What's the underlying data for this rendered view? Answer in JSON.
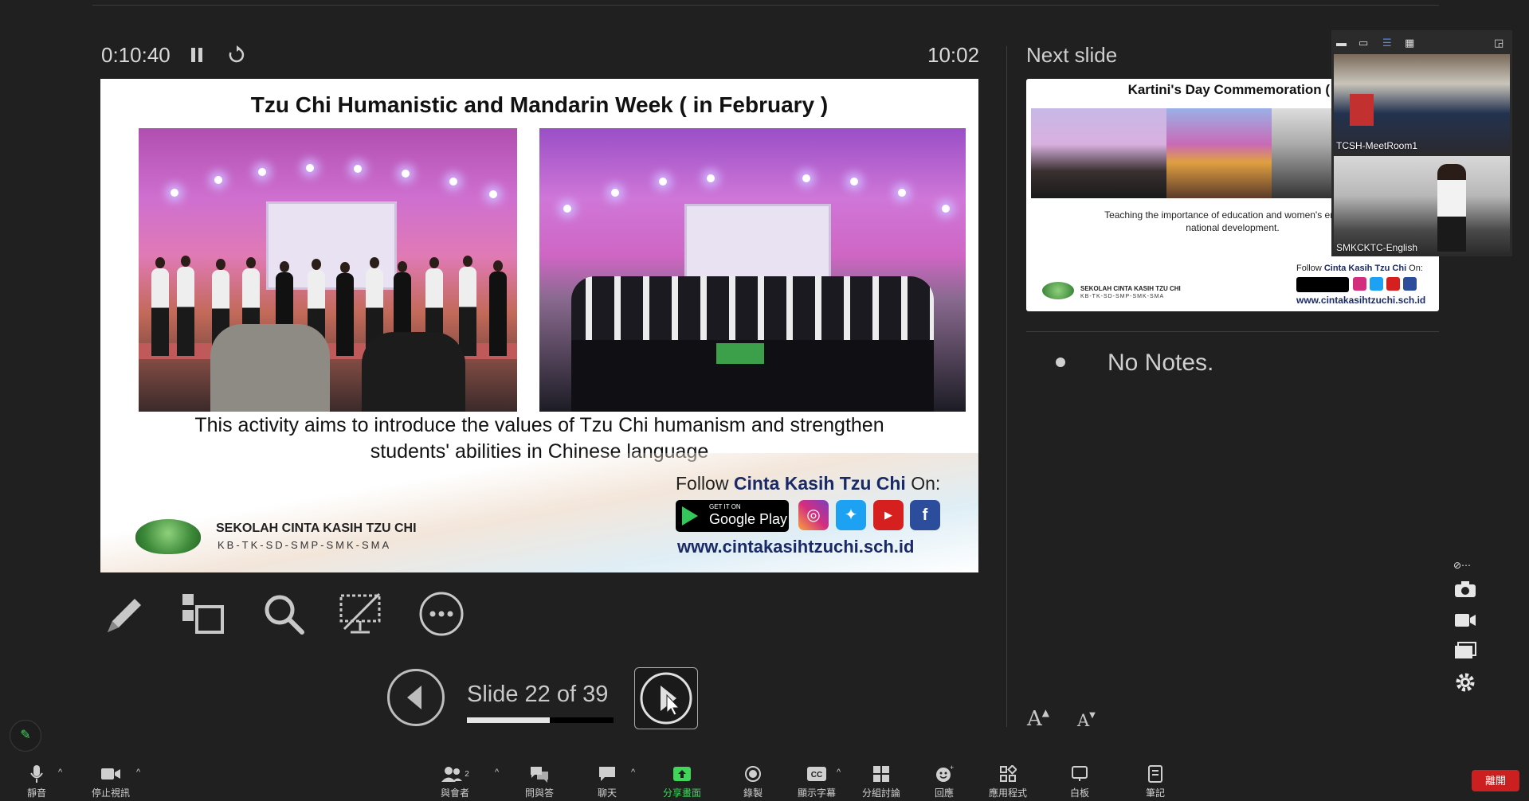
{
  "presenter": {
    "elapsed": "0:10:40",
    "clock": "10:02",
    "next_slide_label": "Next slide"
  },
  "slide": {
    "title": "Tzu Chi Humanistic and Mandarin Week ( in February )",
    "caption_line1": "This activity aims to introduce the values of Tzu Chi humanism and strengthen",
    "caption_line2": "students' abilities in Chinese language",
    "school_name": "SEKOLAH CINTA KASIH TZU CHI",
    "school_levels": "KB-TK-SD-SMP-SMK-SMA",
    "follow_prefix": "Follow ",
    "follow_brand": "Cinta Kasih Tzu Chi",
    "follow_suffix": " On:",
    "gplay_small": "GET IT ON",
    "gplay_big": "Google Play",
    "website": "www.cintakasihtzuchi.sch.id"
  },
  "navigation": {
    "slide_count": "Slide 22 of 39",
    "progress": 0.564
  },
  "next_slide": {
    "title": "Kartini's Day Commemoration ( i",
    "caption_line1": "Teaching the importance of education and women's empowe",
    "caption_line2": "national development.",
    "school_name": "SEKOLAH CINTA KASIH TZU CHI",
    "school_levels": "KB-TK-SD-SMP-SMK-SMA",
    "follow_prefix": "Follow ",
    "follow_brand": "Cinta Kasih Tzu Chi",
    "follow_suffix": " On:",
    "website": "www.cintakasihtzuchi.sch.id"
  },
  "notes": {
    "text": "No Notes."
  },
  "video_panel": {
    "participants": [
      {
        "name": "TCSH-MeetRoom1"
      },
      {
        "name": "SMKCKTC-English"
      }
    ]
  },
  "toolbar": {
    "mute": "靜音",
    "stop_video": "停止視訊",
    "participants": "與會者",
    "participant_count": "2",
    "qa": "問與答",
    "chat": "聊天",
    "share_screen": "分享畫面",
    "record": "錄製",
    "captions": "顯示字幕",
    "breakout": "分組討論",
    "reactions": "回應",
    "apps": "應用程式",
    "whiteboard": "白板",
    "notes": "筆記",
    "end": "離開"
  },
  "colors": {
    "background": "#202020",
    "share_green": "#3fd65a",
    "end_red": "#cc1f1f"
  }
}
